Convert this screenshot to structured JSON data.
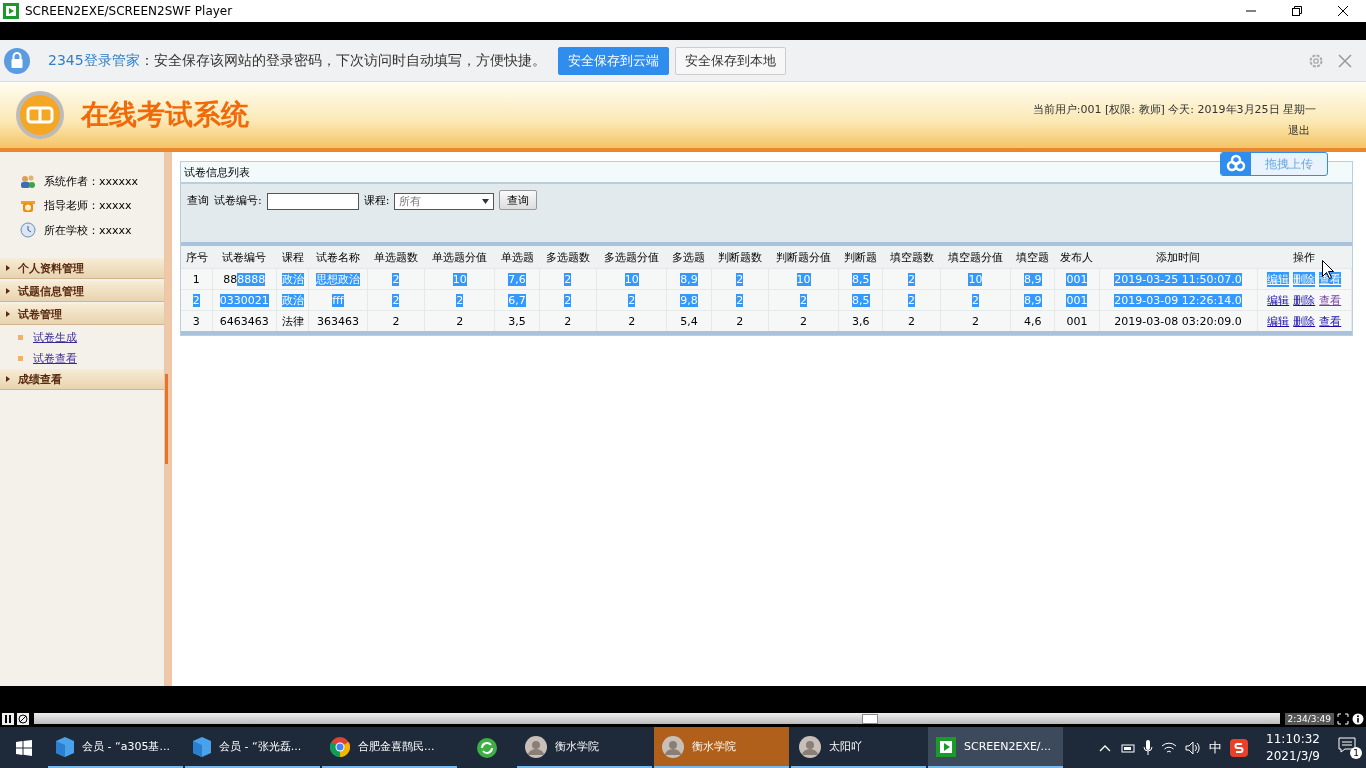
{
  "window": {
    "title": "SCREEN2EXE/SCREEN2SWF Player"
  },
  "login_bar": {
    "brand": "2345登录管家",
    "message": "：安全保存该网站的登录密码，下次访问时自动填写，方便快捷。",
    "buttons": [
      {
        "label": "安全保存到云端",
        "primary": true
      },
      {
        "label": "安全保存到本地",
        "primary": false
      }
    ]
  },
  "header": {
    "title": "在线考试系统",
    "user_info": "当前用户:001 [权限: 教师] 今天:  2019年3月25日  星期一",
    "logout": "退出"
  },
  "sidebar": {
    "info": [
      {
        "kind": "author",
        "text": "系统作者：xxxxxx"
      },
      {
        "kind": "teacher",
        "text": "指导老师：xxxxx"
      },
      {
        "kind": "school",
        "text": "所在学校：xxxxx"
      }
    ],
    "menu": [
      {
        "label": "个人资料管理"
      },
      {
        "label": "试题信息管理"
      },
      {
        "label": "试卷管理",
        "children": [
          {
            "label": "试卷生成"
          },
          {
            "label": "试卷查看"
          }
        ]
      },
      {
        "label": "成绩查看"
      }
    ]
  },
  "upload_button": {
    "label": "拖拽上传"
  },
  "panel": {
    "title": "试卷信息列表",
    "search": {
      "label": "查询",
      "id_label": "试卷编号:",
      "course_label": "课程:",
      "course_value": "所有",
      "button": "查询"
    }
  },
  "table": {
    "columns": [
      "序号",
      "试卷编号",
      "课程",
      "试卷名称",
      "单选题数",
      "单选题分值",
      "单选题",
      "多选题数",
      "多选题分值",
      "多选题",
      "判断题数",
      "判断题分值",
      "判断题",
      "填空题数",
      "填空题分值",
      "填空题",
      "发布人",
      "添加时间",
      "操作"
    ],
    "rows": [
      {
        "cells": [
          [
            {
              "text": "1",
              "selected": false
            }
          ],
          [
            {
              "text": "88",
              "selected": false
            },
            {
              "text": "8888",
              "selected": true
            }
          ],
          [
            {
              "text": "政治",
              "selected": true
            }
          ],
          [
            {
              "text": "思想政治",
              "selected": true
            }
          ],
          [
            {
              "text": "2",
              "selected": true
            }
          ],
          [
            {
              "text": "10",
              "selected": true
            }
          ],
          [
            {
              "text": "7,6",
              "selected": true
            }
          ],
          [
            {
              "text": "2",
              "selected": true
            }
          ],
          [
            {
              "text": "10",
              "selected": true
            }
          ],
          [
            {
              "text": "8,9",
              "selected": true
            }
          ],
          [
            {
              "text": "2",
              "selected": true
            }
          ],
          [
            {
              "text": "10",
              "selected": true
            }
          ],
          [
            {
              "text": "8,5",
              "selected": true
            }
          ],
          [
            {
              "text": "2",
              "selected": true
            }
          ],
          [
            {
              "text": "10",
              "selected": true
            }
          ],
          [
            {
              "text": "8,9",
              "selected": true
            }
          ],
          [
            {
              "text": "001",
              "selected": true
            }
          ],
          [
            {
              "text": "2019-03-25 11:50:07.0",
              "selected": true
            }
          ]
        ],
        "actions": [
          {
            "label": "编辑",
            "selected": true,
            "visited": false
          },
          {
            "label": "删除",
            "selected": true,
            "visited": false
          },
          {
            "label": "查看",
            "selected": true,
            "visited": false
          }
        ]
      },
      {
        "cells": [
          [
            {
              "text": "2",
              "selected": true
            }
          ],
          [
            {
              "text": "0330021",
              "selected": true
            }
          ],
          [
            {
              "text": "政治",
              "selected": true
            }
          ],
          [
            {
              "text": "fff",
              "selected": true
            }
          ],
          [
            {
              "text": "2",
              "selected": true
            }
          ],
          [
            {
              "text": "2",
              "selected": true
            }
          ],
          [
            {
              "text": "6,7",
              "selected": true
            }
          ],
          [
            {
              "text": "2",
              "selected": true
            }
          ],
          [
            {
              "text": "2",
              "selected": true
            }
          ],
          [
            {
              "text": "9,8",
              "selected": true
            }
          ],
          [
            {
              "text": "2",
              "selected": true
            }
          ],
          [
            {
              "text": "2",
              "selected": true
            }
          ],
          [
            {
              "text": "8,5",
              "selected": true
            }
          ],
          [
            {
              "text": "2",
              "selected": true
            }
          ],
          [
            {
              "text": "2",
              "selected": true
            }
          ],
          [
            {
              "text": "8,9",
              "selected": true
            }
          ],
          [
            {
              "text": "001",
              "selected": true
            }
          ],
          [
            {
              "text": "2019-03-09 12:26:14.0",
              "selected": true
            }
          ]
        ],
        "actions": [
          {
            "label": "编辑",
            "selected": false,
            "visited": false
          },
          {
            "label": "删除",
            "selected": false,
            "visited": false
          },
          {
            "label": "查看",
            "selected": false,
            "visited": true
          }
        ]
      },
      {
        "cells": [
          [
            {
              "text": "3",
              "selected": false
            }
          ],
          [
            {
              "text": "6463463",
              "selected": false
            }
          ],
          [
            {
              "text": "法律",
              "selected": false
            }
          ],
          [
            {
              "text": "363463",
              "selected": false
            }
          ],
          [
            {
              "text": "2",
              "selected": false
            }
          ],
          [
            {
              "text": "2",
              "selected": false
            }
          ],
          [
            {
              "text": "3,5",
              "selected": false
            }
          ],
          [
            {
              "text": "2",
              "selected": false
            }
          ],
          [
            {
              "text": "2",
              "selected": false
            }
          ],
          [
            {
              "text": "5,4",
              "selected": false
            }
          ],
          [
            {
              "text": "2",
              "selected": false
            }
          ],
          [
            {
              "text": "2",
              "selected": false
            }
          ],
          [
            {
              "text": "3,6",
              "selected": false
            }
          ],
          [
            {
              "text": "2",
              "selected": false
            }
          ],
          [
            {
              "text": "2",
              "selected": false
            }
          ],
          [
            {
              "text": "4,6",
              "selected": false
            }
          ],
          [
            {
              "text": "001",
              "selected": false
            }
          ],
          [
            {
              "text": "2019-03-08 03:20:09.0",
              "selected": false
            }
          ]
        ],
        "actions": [
          {
            "label": "编辑",
            "selected": false,
            "visited": false
          },
          {
            "label": "删除",
            "selected": false,
            "visited": false
          },
          {
            "label": "查看",
            "selected": false,
            "visited": false
          }
        ]
      }
    ]
  },
  "player": {
    "level": 0.67,
    "time": "2:34/3:49"
  },
  "taskbar": {
    "apps": [
      {
        "kind": "box",
        "label": "会员 - “a305基...",
        "selected": false,
        "attention": false
      },
      {
        "kind": "box",
        "label": "会员 - “张光磊...",
        "selected": false,
        "attention": false
      },
      {
        "kind": "chrome",
        "label": "合肥金喜鹊民...",
        "selected": false,
        "attention": false
      },
      {
        "kind": "refresh",
        "selected": false,
        "attention": false
      },
      {
        "kind": "avatar",
        "label": "衡水学院",
        "selected": false,
        "attention": false
      },
      {
        "kind": "avatar",
        "label": "衡水学院",
        "selected": false,
        "attention": true
      },
      {
        "kind": "avatar",
        "label": "太阳吖",
        "selected": false,
        "attention": false
      },
      {
        "kind": "player",
        "label": "SCREEN2EXE/...",
        "selected": true,
        "attention": false
      }
    ],
    "ime": "中",
    "time": "11:10:32",
    "date": "2021/3/9",
    "notifications": "1"
  }
}
